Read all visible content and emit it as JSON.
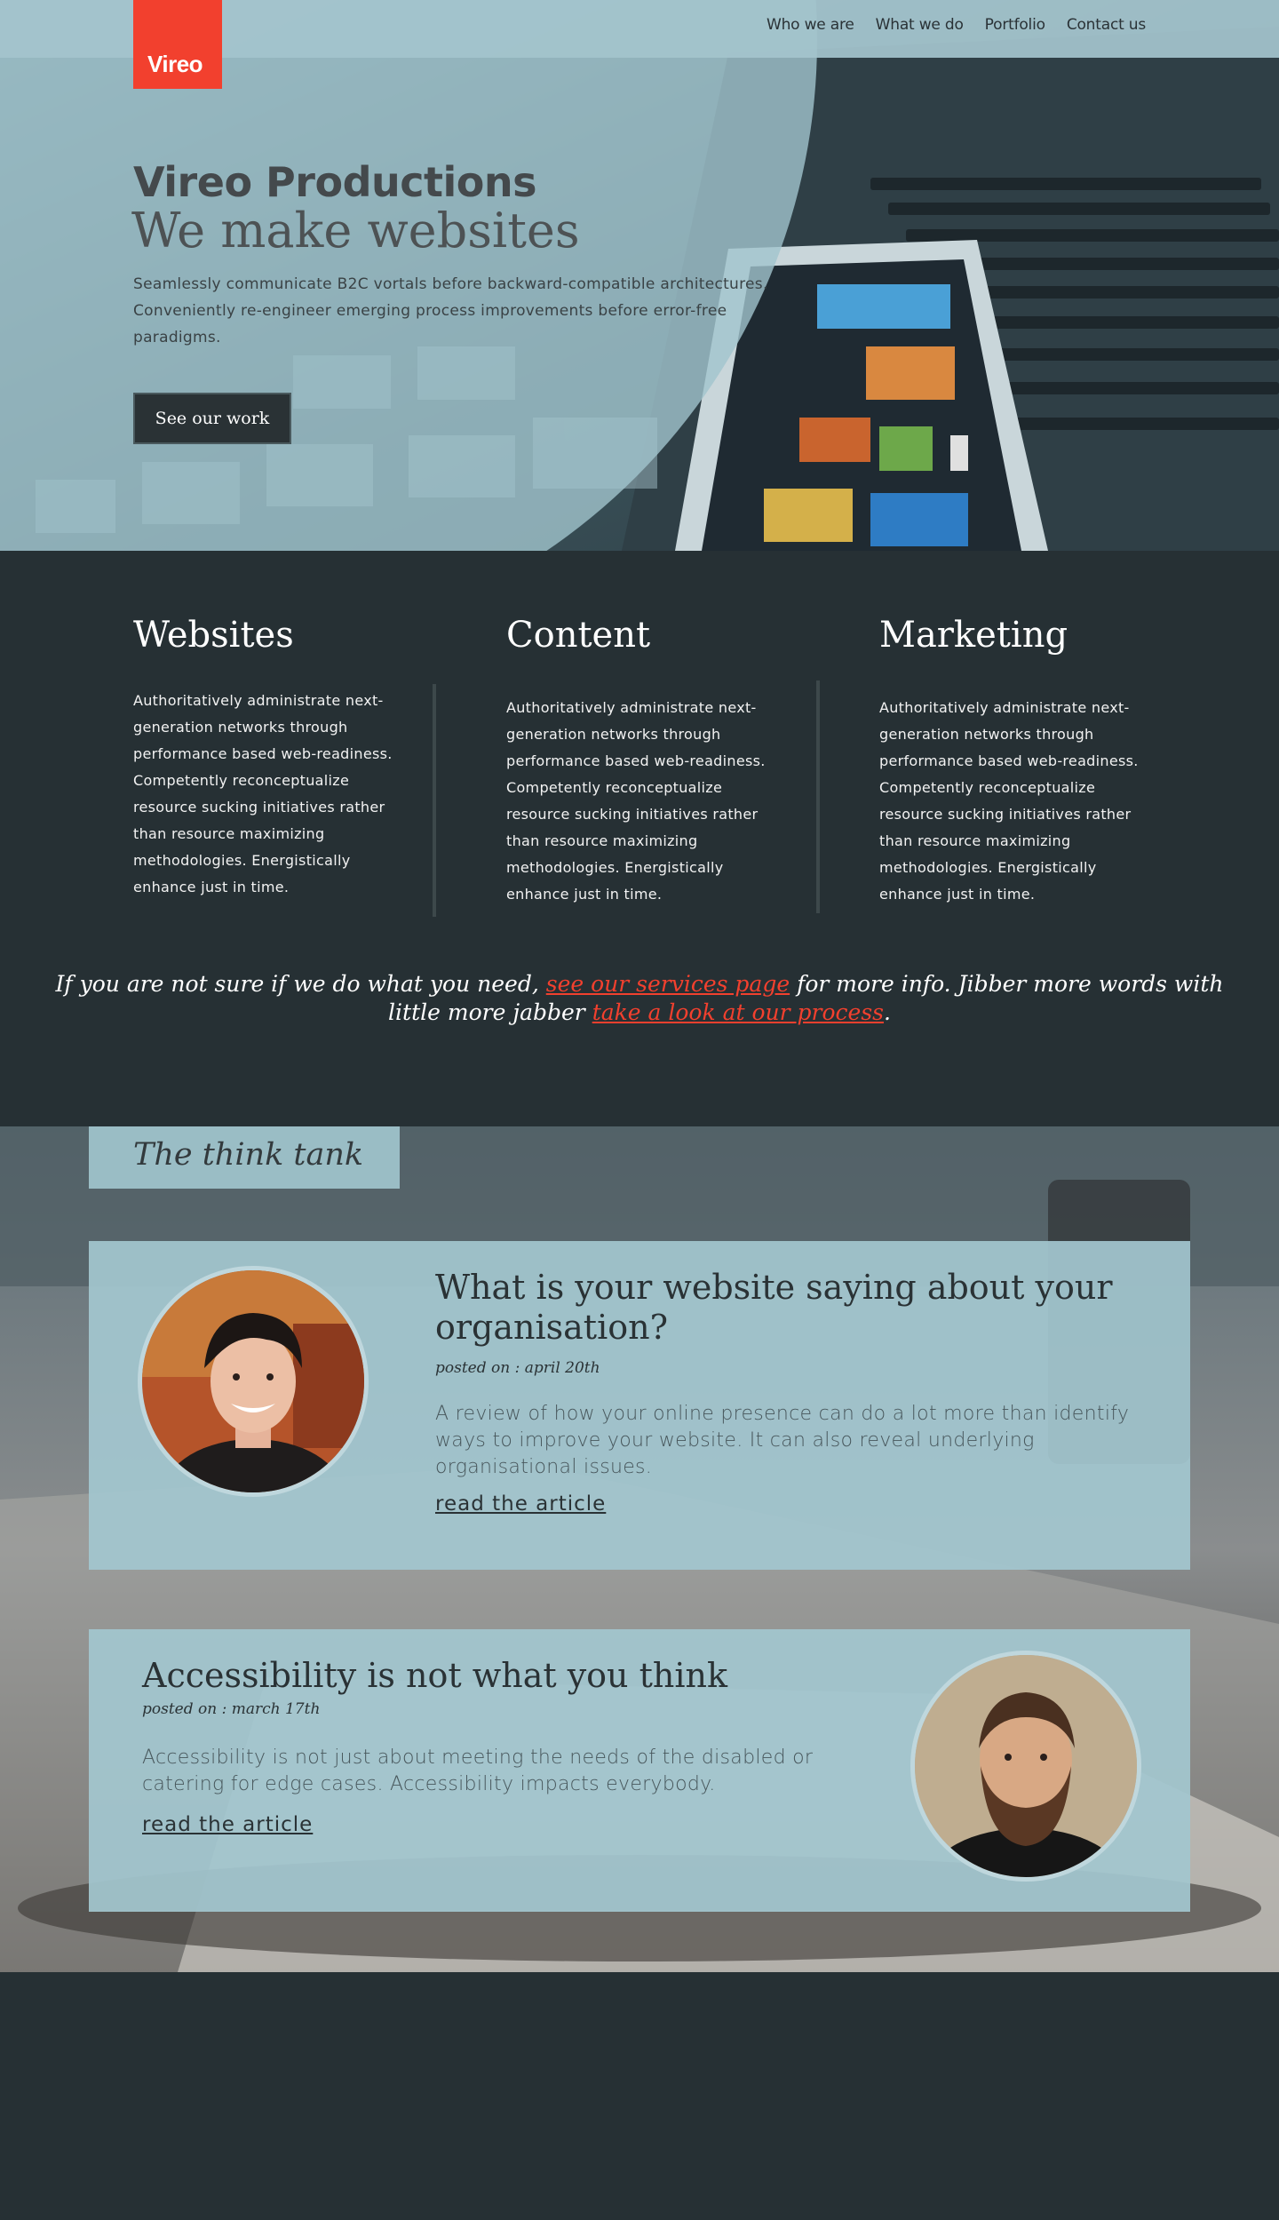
{
  "brand": {
    "logo_text": "Vireo",
    "accent": "#f2402e",
    "dark": "#263034",
    "panel": "#a3c6cf"
  },
  "nav": {
    "items": [
      "Who we are",
      "What we do",
      "Portfolio",
      "Contact us"
    ]
  },
  "hero": {
    "title": "Vireo Productions",
    "subtitle": "We make websites",
    "body": "Seamlessly communicate B2C vortals before backward-compatible architectures. Conveniently re-engineer emerging process improvements before error-free paradigms.",
    "button": "See our work"
  },
  "services": [
    {
      "title": "Websites",
      "body": "Authoritatively administrate next-generation networks through performance based web-readiness. Competently reconceptualize resource sucking initiatives rather than resource maximizing methodologies. Energistically enhance just in time."
    },
    {
      "title": "Content",
      "body": "Authoritatively administrate next-generation networks through performance based web-readiness. Competently reconceptualize resource sucking initiatives rather than resource maximizing methodologies. Energistically enhance just in time."
    },
    {
      "title": "Marketing",
      "body": "Authoritatively administrate next-generation networks through performance based web-readiness. Competently reconceptualize resource sucking initiatives rather than resource maximizing methodologies. Energistically enhance just in time."
    }
  ],
  "cta": {
    "text1": "If you are not sure if we do what you need, ",
    "link1": "see our services page",
    "text2": " for more info. Jibber more words  with",
    "text3": "little more jabber ",
    "link2": "take a look at our process",
    "text4": "."
  },
  "think_tank": {
    "label": "The think tank",
    "articles": [
      {
        "title": "What is your website saying about your organisation?",
        "date": "posted on : april 20th",
        "excerpt": "A review of how your online presence can do a lot more than identify ways to improve your website. It can also reveal underlying organisational issues.",
        "link": "read the article"
      },
      {
        "title": "Accessibility is not what you think",
        "date": "posted on : march 17th",
        "excerpt": "Accessibility is not just about meeting the needs of the disabled or catering for edge cases. Accessibility impacts everybody.",
        "link": "read the article"
      }
    ]
  }
}
